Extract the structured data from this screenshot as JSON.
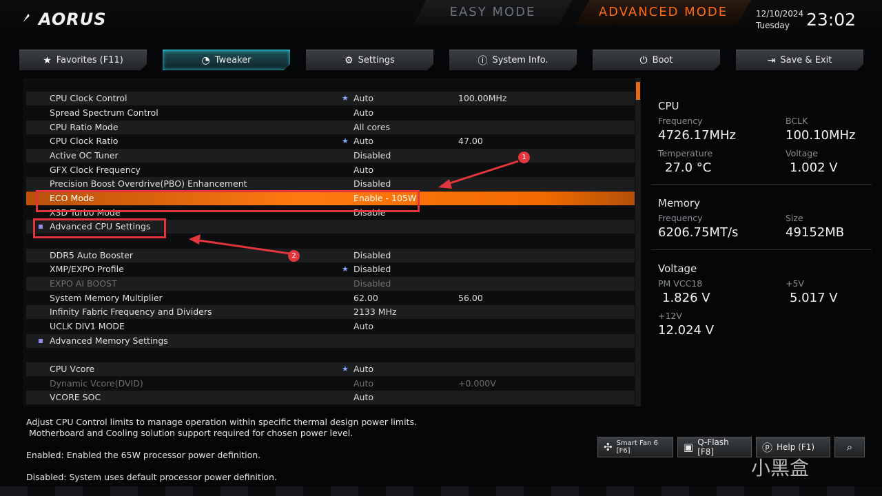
{
  "header": {
    "brand": "AORUS",
    "easy_mode": "EASY MODE",
    "advanced_mode": "ADVANCED MODE",
    "date": "12/10/2024",
    "day": "Tuesday",
    "time": "23:02"
  },
  "tabs": [
    {
      "label": "Favorites (F11)",
      "icon": "star-icon"
    },
    {
      "label": "Tweaker",
      "icon": "speedometer-icon",
      "active": true
    },
    {
      "label": "Settings",
      "icon": "gear-icon"
    },
    {
      "label": "System Info.",
      "icon": "info-icon"
    },
    {
      "label": "Boot",
      "icon": "power-icon"
    },
    {
      "label": "Save & Exit",
      "icon": "exit-icon"
    }
  ],
  "settings": {
    "rows": [
      {
        "label": "CPU Clock Control",
        "value": "Auto",
        "value2": "100.00MHz",
        "star": true
      },
      {
        "label": "Spread Spectrum Control",
        "value": "Auto",
        "value2": ""
      },
      {
        "label": "CPU Ratio Mode",
        "value": "All cores",
        "value2": ""
      },
      {
        "label": "CPU Clock Ratio",
        "value": "Auto",
        "value2": "47.00",
        "star": true
      },
      {
        "label": "Active OC Tuner",
        "value": "Disabled",
        "value2": ""
      },
      {
        "label": "GFX Clock Frequency",
        "value": "Auto",
        "value2": ""
      },
      {
        "label": "Precision Boost Overdrive(PBO) Enhancement",
        "value": "Disabled",
        "value2": ""
      },
      {
        "label": "ECO Mode",
        "value": "Enable - 105W",
        "value2": "",
        "selected": true
      },
      {
        "label": "X3D Turbo Mode",
        "value": "Disable",
        "value2": ""
      },
      {
        "label": "Advanced CPU Settings",
        "value": "",
        "value2": "",
        "submenu": true
      },
      {
        "label": "",
        "value": "",
        "value2": ""
      },
      {
        "label": "DDR5 Auto Booster",
        "value": "Disabled",
        "value2": ""
      },
      {
        "label": "XMP/EXPO Profile",
        "value": "Disabled",
        "value2": "",
        "star": true
      },
      {
        "label": "EXPO AI BOOST",
        "value": "Disabled",
        "value2": "",
        "dim": true
      },
      {
        "label": "System Memory Multiplier",
        "value": "62.00",
        "value2": "56.00"
      },
      {
        "label": "Infinity Fabric Frequency and Dividers",
        "value": "2133 MHz",
        "value2": ""
      },
      {
        "label": "UCLK DIV1 MODE",
        "value": "Auto",
        "value2": ""
      },
      {
        "label": "Advanced Memory Settings",
        "value": "",
        "value2": "",
        "submenu": true
      },
      {
        "label": "",
        "value": "",
        "value2": ""
      },
      {
        "label": "CPU Vcore",
        "value": "Auto",
        "value2": "",
        "star": true
      },
      {
        "label": "Dynamic Vcore(DVID)",
        "value": "Auto",
        "value2": "+0.000V",
        "dim": true
      },
      {
        "label": "VCORE SOC",
        "value": "Auto",
        "value2": ""
      }
    ]
  },
  "annotations": {
    "badge1": "1",
    "badge2": "2"
  },
  "info": {
    "cpu": {
      "title": "CPU",
      "freq_label": "Frequency",
      "freq": "4726.17MHz",
      "bclk_label": "BCLK",
      "bclk": "100.10MHz",
      "temp_label": "Temperature",
      "temp": "27.0 °C",
      "volt_label": "Voltage",
      "volt": "1.002 V"
    },
    "memory": {
      "title": "Memory",
      "freq_label": "Frequency",
      "freq": "6206.75MT/s",
      "size_label": "Size",
      "size": "49152MB"
    },
    "voltage": {
      "title": "Voltage",
      "vcc18_label": "PM VCC18",
      "vcc18": "1.826 V",
      "v5_label": "+5V",
      "v5": "5.017 V",
      "v12_label": "+12V",
      "v12": "12.024 V"
    }
  },
  "help": {
    "line1": "Adjust CPU Control limits to manage operation within specific thermal design power limits.",
    "line2": " Motherboard and Cooling solution support required for chosen power level.",
    "line3": "Enabled: Enabled the 65W processor power definition.",
    "line4": "Disabled: System uses default processor power definition."
  },
  "footer_buttons": {
    "smartfan": "Smart Fan 6 [F6]",
    "qflash": "Q-Flash [F8]",
    "help": "Help (F1)"
  },
  "watermark": "小黑盒",
  "colors": {
    "accent_orange": "#ff7a10",
    "tab_active_cyan": "#3cd7e8",
    "annotation_red": "#e2363c"
  }
}
